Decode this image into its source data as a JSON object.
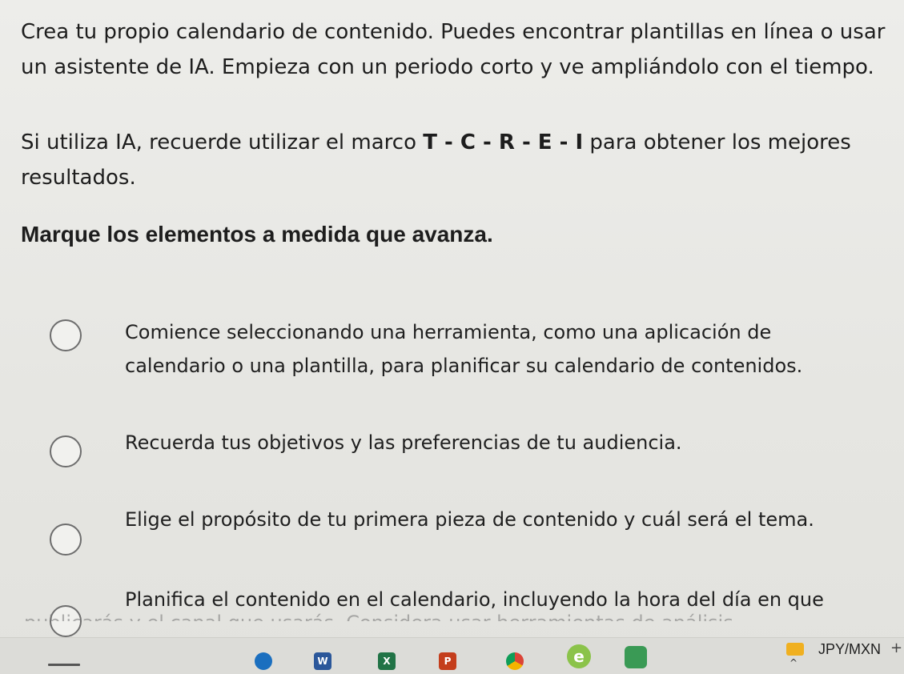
{
  "intro": {
    "text": "Crea tu propio calendario de contenido. Puedes encontrar plantillas en línea o usar un asistente de IA. Empieza con un periodo corto y ve ampliándolo con el tiempo."
  },
  "framework": {
    "prefix": "Si utiliza IA, recuerde utilizar el marco ",
    "acronym": "T - C - R - E - I",
    "suffix": " para obtener los mejores resultados."
  },
  "instruction": "Marque los elementos a medida que avanza.",
  "tasks": [
    {
      "label": "Comience seleccionando una herramienta, como una aplicación de calendario o una plantilla, para planificar su calendario de contenidos."
    },
    {
      "label": "Recuerda tus objetivos y las preferencias de tu audiencia."
    },
    {
      "label": "Elige el propósito de tu primera pieza de contenido y cuál será el tema."
    },
    {
      "label": "Planifica el contenido en el calendario, incluyendo la hora del día en que"
    }
  ],
  "cutoff_text": "publicarás y el canal que usarás. Considera usar herramientas de análisis",
  "taskbar": {
    "currency": "JPY/MXN",
    "plus": "+",
    "chevron": "^",
    "icons": {
      "word": "W",
      "excel": "X",
      "powerpoint": "P",
      "ie": "e"
    }
  }
}
